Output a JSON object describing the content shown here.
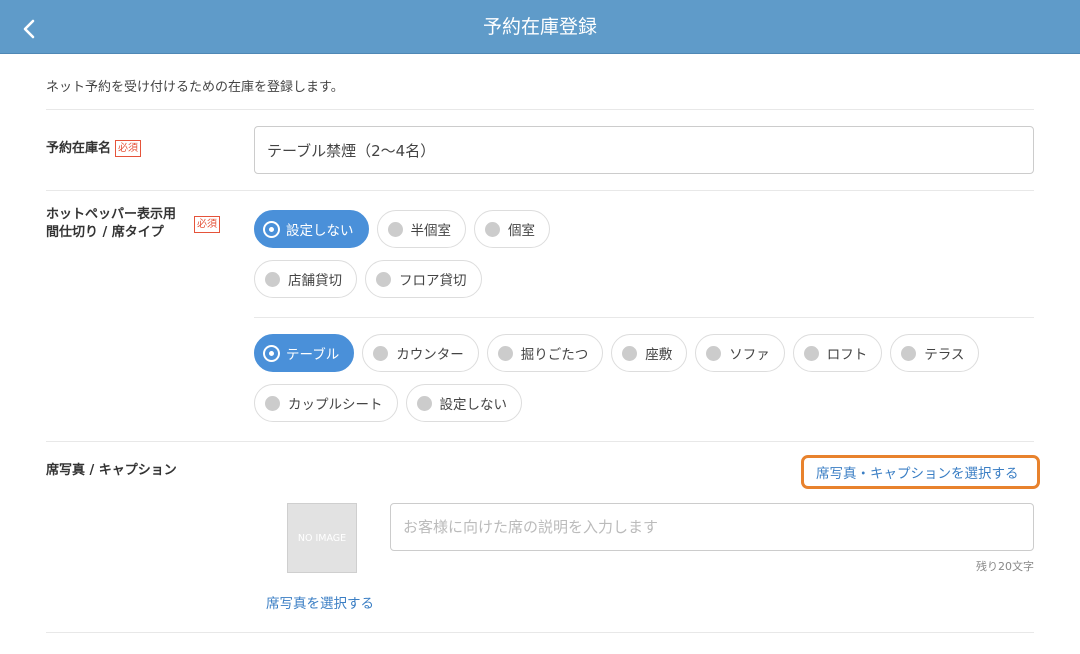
{
  "header": {
    "title": "予約在庫登録"
  },
  "description": "ネット予約を受け付けるための在庫を登録します。",
  "required_badge": "必須",
  "stock_name": {
    "label": "予約在庫名",
    "value": "テーブル禁煙（2〜4名）"
  },
  "seat_type": {
    "label_line1": "ホットペッパー表示用",
    "label_line2": "間仕切り / 席タイプ",
    "partition_options": [
      "設定しない",
      "半個室",
      "個室",
      "店舗貸切",
      "フロア貸切"
    ],
    "partition_selected": "設定しない",
    "seat_options": [
      "テーブル",
      "カウンター",
      "掘りごたつ",
      "座敷",
      "ソファ",
      "ロフト",
      "テラス",
      "カップルシート",
      "設定しない"
    ],
    "seat_selected": "テーブル"
  },
  "photo": {
    "label": "席写真 / キャプション",
    "select_both_link": "席写真・キャプションを選択する",
    "no_image_text": "NO IMAGE",
    "select_photo_link": "席写真を選択する",
    "caption_placeholder": "お客様に向けた席の説明を入力します",
    "remaining": "残り20文字"
  },
  "colors": {
    "header": "#5f9bc9",
    "accent": "#4a90d9",
    "required": "#e5533a",
    "focus": "#e8822d"
  },
  "icons": {
    "back": "chevron-left-icon"
  }
}
